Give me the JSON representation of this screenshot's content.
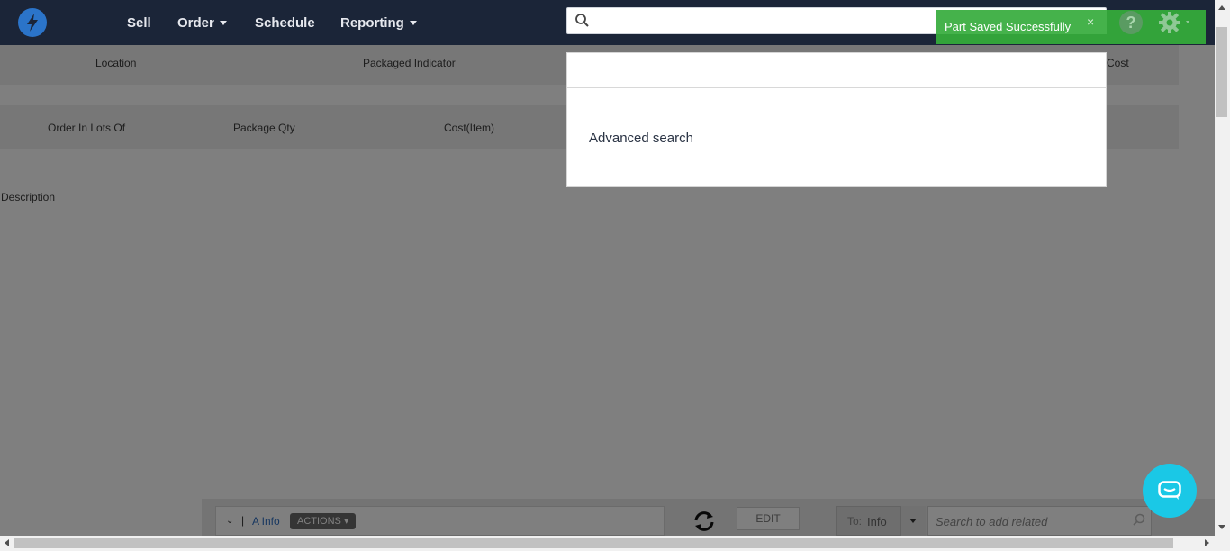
{
  "nav": {
    "items": [
      {
        "label": "Sell"
      },
      {
        "label": "Order"
      },
      {
        "label": "Schedule"
      },
      {
        "label": "Reporting"
      }
    ]
  },
  "search": {
    "placeholder": "",
    "value": ""
  },
  "toast": {
    "message": "Part Saved Successfully",
    "close": "×"
  },
  "help": {
    "glyph": "?"
  },
  "content": {
    "row1": [
      "Location",
      "Packaged Indicator",
      "Cost"
    ],
    "row2": [
      "Order In Lots Of",
      "Package Qty",
      "Cost(Item)"
    ],
    "description_label": "Description"
  },
  "dropdown": {
    "advanced_search": "Advanced search"
  },
  "bottom_bar": {
    "info_link": "A Info",
    "actions": "ACTIONS",
    "pipe": "|",
    "edit": "EDIT",
    "to_label": "To:",
    "to_value": "Info",
    "related_placeholder": "Search to add related"
  },
  "colors": {
    "nav_bg": "#1b2538",
    "toast_bg": "#45b24b",
    "chat_bg": "#1ac8e6",
    "link": "#2f6ec0"
  },
  "icons": [
    "logo-icon",
    "caret-down-icon",
    "search-icon",
    "close-icon",
    "help-icon",
    "gear-icon",
    "chevron-down-icon",
    "refresh-icon",
    "chat-icon"
  ]
}
